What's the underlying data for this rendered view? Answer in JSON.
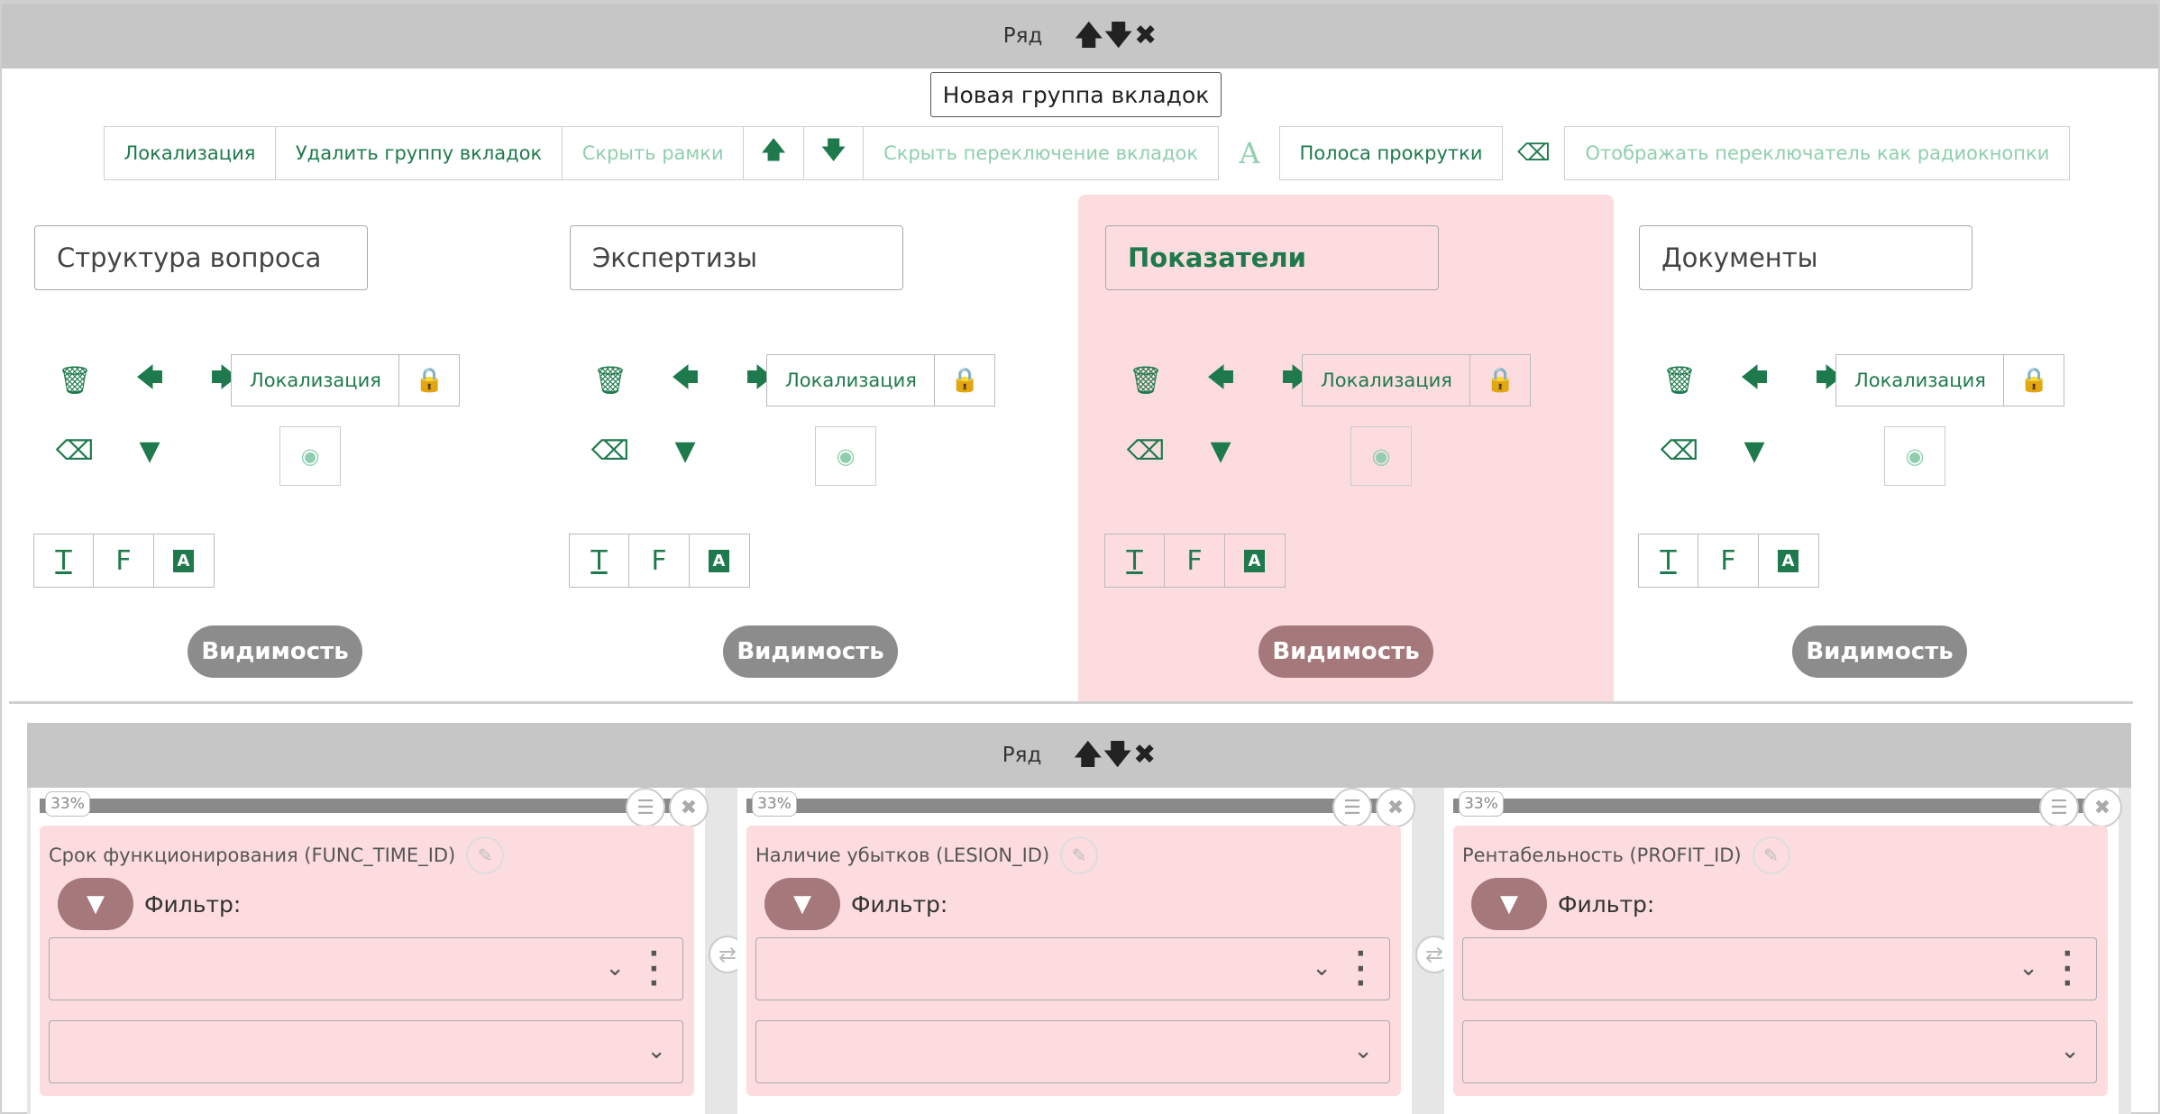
{
  "row1": {
    "label": "Ряд",
    "icons": [
      "arrow-up-icon",
      "arrow-down-icon",
      "close-icon"
    ]
  },
  "group_name": "Новая группа вкладок",
  "toolbar": {
    "localization": "Локализация",
    "delete_group": "Удалить группу вкладок",
    "hide_borders": "Скрыть рамки",
    "hide_tab_switch": "Скрыть переключение вкладок",
    "scrollbar": "Полоса прокрутки",
    "radio_switch": "Отображать переключатель как радиокнопки"
  },
  "tabs": [
    {
      "name": "Структура вопроса",
      "active": false
    },
    {
      "name": "Экспертизы",
      "active": false
    },
    {
      "name": "Показатели",
      "active": true
    },
    {
      "name": "Документы",
      "active": false
    }
  ],
  "tab_labels": {
    "localization": "Локализация",
    "visibility": "Видимость",
    "fmt_t": "T",
    "fmt_f": "F",
    "fmt_a": "A"
  },
  "row2": {
    "label": "Ряд"
  },
  "cells": [
    {
      "percent": "33%",
      "title": "Срок функционирования (FUNC_TIME_ID)",
      "filter_label": "Фильтр:"
    },
    {
      "percent": "33%",
      "title": "Наличие убытков (LESION_ID)",
      "filter_label": "Фильтр:"
    },
    {
      "percent": "33%",
      "title": "Рентабельность (PROFIT_ID)",
      "filter_label": "Фильтр:"
    }
  ],
  "colors": {
    "accent": "#1e7a4c",
    "active_tab_bg": "#fcdcdf",
    "row_bar": "#c6c6c6"
  }
}
